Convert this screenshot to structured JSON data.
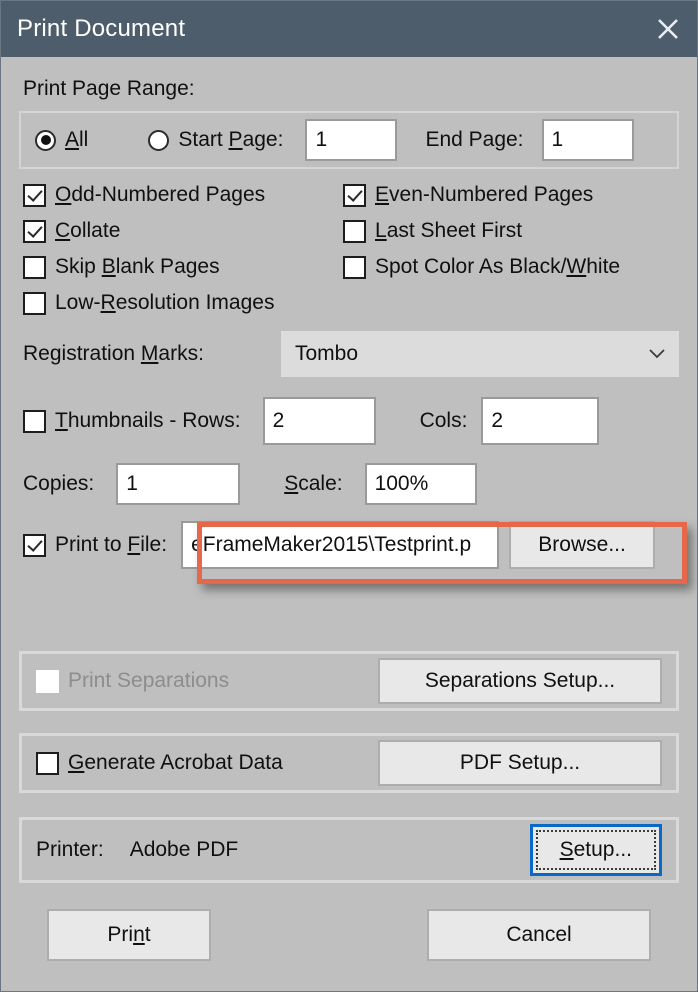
{
  "window": {
    "title": "Print Document",
    "close_icon": "close-icon"
  },
  "page_range": {
    "section_label": "Print Page Range:",
    "all": {
      "label": "All",
      "accel": "A",
      "selected": true
    },
    "start_page": {
      "label": "Start Page:",
      "accel": "P",
      "selected": false,
      "value": "1"
    },
    "end_page": {
      "label": "End Page:",
      "value": "1"
    }
  },
  "options": [
    {
      "label": "Odd-Numbered Pages",
      "accel": "O",
      "checked": true,
      "disabled": false
    },
    {
      "label": "Even-Numbered Pages",
      "accel": "E",
      "checked": true,
      "disabled": false
    },
    {
      "label": "Collate",
      "accel": "C",
      "checked": true,
      "disabled": false
    },
    {
      "label": "Last Sheet First",
      "accel": "L",
      "checked": false,
      "disabled": false
    },
    {
      "label": "Skip Blank Pages",
      "accel": "B",
      "checked": false,
      "disabled": false
    },
    {
      "label": "Spot Color As Black/White",
      "accel": "W",
      "checked": false,
      "disabled": false
    },
    {
      "label": "Low-Resolution Images",
      "accel": "R",
      "checked": false,
      "disabled": false
    }
  ],
  "registration": {
    "label": "Registration Marks:",
    "accel": "M",
    "selected_value": "Tombo",
    "chevron_icon": "chevron-down-icon"
  },
  "thumbnails": {
    "label": "Thumbnails - Rows:",
    "accel": "T",
    "checked": false,
    "rows_value": "2",
    "cols_label": "Cols:",
    "cols_value": "2"
  },
  "copies": {
    "label": "Copies:",
    "value": "1"
  },
  "scale": {
    "label": "Scale:",
    "accel": "S",
    "value": "100%"
  },
  "print_to_file": {
    "label": "Print to File:",
    "accel": "F",
    "checked": true,
    "path_value": "eFrameMaker2015\\Testprint.p",
    "browse_label": "Browse...",
    "highlight_color": "#e5684a"
  },
  "separations": {
    "label": "Print Separations",
    "checked": false,
    "disabled": true,
    "button_label": "Separations Setup..."
  },
  "acrobat": {
    "label": "Generate Acrobat Data",
    "accel": "G",
    "checked": false,
    "button_label": "PDF Setup..."
  },
  "printer": {
    "label": "Printer:",
    "name": "Adobe PDF",
    "setup_label": "Setup...",
    "setup_accel": "S",
    "focus_color": "#0a68c8"
  },
  "footer": {
    "print_label": "Print",
    "print_accel": "n",
    "cancel_label": "Cancel"
  }
}
